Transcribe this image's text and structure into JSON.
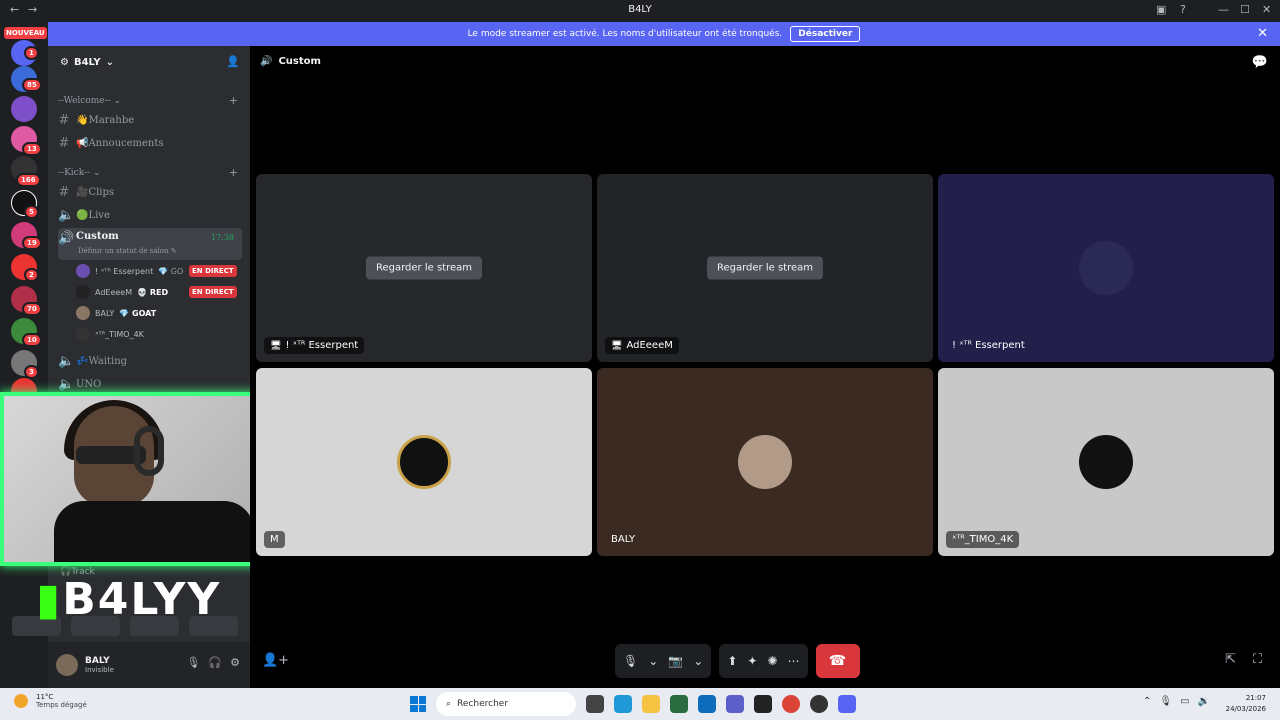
{
  "window": {
    "title": "B4LY",
    "back": "←",
    "forward": "→"
  },
  "banner": {
    "text": "Le mode streamer est activé. Les noms d'utilisateur ont été tronqués.",
    "button": "Désactiver",
    "close": "✕"
  },
  "rail": {
    "nouveau": "NOUVEAU",
    "badges": [
      "1",
      "85",
      "13",
      "166",
      "5",
      "19",
      "2",
      "70",
      "10",
      "3"
    ]
  },
  "sidebar": {
    "guild_name": "B4LY",
    "categories": [
      {
        "label": "--Welcome--"
      },
      {
        "label": "--Kick--"
      }
    ],
    "channels": {
      "marahbe": "👋Marahbe",
      "annoucements": "📢Annoucements",
      "clips": "🎥Clips",
      "live": "🟢Live",
      "custom": "Custom",
      "custom_time": "17:38",
      "custom_status": "Définir un statut de salon ✎",
      "waiting": "💤Waiting",
      "uno": "UNO",
      "track": "🎧Track"
    },
    "members": [
      {
        "name": "! ˣᵀᴿ Esserpent",
        "tag": "💎 GO",
        "live": "EN DIRECT"
      },
      {
        "name": "AdEeeeM",
        "tag": "💀 RED",
        "live": "EN DIRECT"
      },
      {
        "name": "BALY",
        "tag": "💎 GOAT",
        "live": ""
      },
      {
        "name": "ˣᵀᴿ_TIMO_4K",
        "tag": "",
        "live": ""
      }
    ]
  },
  "overlay": {
    "logo_text": "B4LYY"
  },
  "user": {
    "name": "BALY",
    "status": "Invisible"
  },
  "main": {
    "channel_title": "Custom",
    "tiles": [
      {
        "label": "! ˣᵀᴿ Esserpent",
        "watch": "Regarder le stream"
      },
      {
        "label": "AdEeeeM",
        "watch": "Regarder le stream"
      },
      {
        "label": "! ˣᵀᴿ Esserpent"
      },
      {
        "label": "M"
      },
      {
        "label": "BALY"
      },
      {
        "label": "ˣᵀᴿ_TIMO_4K"
      }
    ]
  },
  "taskbar": {
    "temp": "11°C",
    "weather": "Temps dégagé",
    "search_placeholder": "Rechercher",
    "time": "21:07",
    "date": "24/03/2026"
  },
  "colors": {
    "blurple": "#5865f2",
    "live_red": "#da373c",
    "green_glow": "#39ff7a"
  }
}
